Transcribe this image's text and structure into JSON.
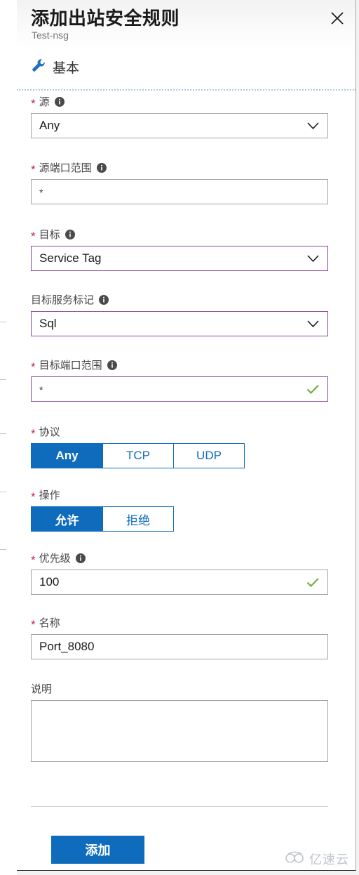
{
  "blade": {
    "title": "添加出站安全规则",
    "subtitle": "Test-nsg",
    "close_icon": "close-icon",
    "section": {
      "icon": "wrench-icon",
      "label": "基本"
    }
  },
  "form": {
    "source": {
      "label": "源",
      "required": true,
      "has_info": true,
      "value": "Any",
      "control": "dropdown"
    },
    "source_port_ranges": {
      "label": "源端口范围",
      "required": true,
      "has_info": true,
      "value": "*",
      "control": "text"
    },
    "destination": {
      "label": "目标",
      "required": true,
      "has_info": true,
      "value": "Service Tag",
      "control": "dropdown",
      "accent": true
    },
    "destination_service_tag": {
      "label": "目标服务标记",
      "required": false,
      "has_info": true,
      "value": "Sql",
      "control": "dropdown",
      "accent": true
    },
    "destination_port_ranges": {
      "label": "目标端口范围",
      "required": true,
      "has_info": true,
      "value": "*",
      "control": "text",
      "accent": true,
      "valid": true
    },
    "protocol": {
      "label": "协议",
      "required": true,
      "has_info": false,
      "options": [
        "Any",
        "TCP",
        "UDP"
      ],
      "selected": "Any"
    },
    "action": {
      "label": "操作",
      "required": true,
      "has_info": false,
      "options": [
        "允许",
        "拒绝"
      ],
      "selected": "允许"
    },
    "priority": {
      "label": "优先级",
      "required": true,
      "has_info": true,
      "value": "100",
      "control": "text",
      "valid": true
    },
    "name": {
      "label": "名称",
      "required": true,
      "has_info": false,
      "value": "Port_8080",
      "control": "text"
    },
    "description": {
      "label": "说明",
      "required": false,
      "has_info": false,
      "value": "",
      "control": "textarea"
    }
  },
  "footer": {
    "add_label": "添加"
  },
  "watermark": {
    "text": "亿速云",
    "icon": "cloud-icon"
  },
  "colors": {
    "accent_blue": "#0f6cbd",
    "modified_purple": "#8b4b9e",
    "valid_green": "#70ad2f",
    "required_red": "#c7254e"
  }
}
